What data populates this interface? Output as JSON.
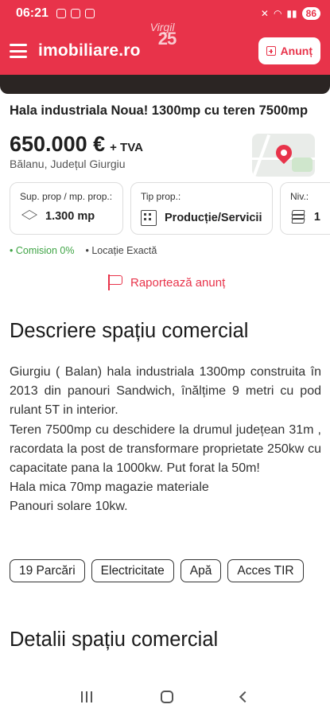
{
  "status_bar": {
    "time": "06:21",
    "battery": "86"
  },
  "header": {
    "logo": "imobiliare.ro",
    "badge_top": "Virgil",
    "badge_number": "25",
    "announce_label": "Anunț"
  },
  "listing": {
    "title": "Hala industriala Noua! 1300mp cu teren 7500mp",
    "price": "650.000 €",
    "vat": "+ TVA",
    "location": "Bălanu, Județul Giurgiu"
  },
  "specs": [
    {
      "label": "Sup. prop / mp. prop.:",
      "value": "1.300 mp",
      "icon": "area-icon"
    },
    {
      "label": "Tip prop.:",
      "value": "Producție/Servicii",
      "icon": "building-icon"
    },
    {
      "label": "Niv.:",
      "value": "1",
      "icon": "layers-icon"
    }
  ],
  "flags": {
    "commission": "Comision 0%",
    "exact_location": "Locație Exactă"
  },
  "report_label": "Raportează anunț",
  "description": {
    "heading": "Descriere spațiu comercial",
    "lines": [
      "Giurgiu ( Balan) hala industriala 1300mp construita în 2013 din panouri Sandwich, înălțime 9 metri cu pod rulant 5T in interior.",
      "Teren 7500mp cu deschidere la drumul județean 31m , racordata la post de transformare proprietate 250kw cu capacitate pana la 1000kw. Put forat la 50m!",
      "Hala mica 70mp magazie materiale",
      "Panouri solare 10kw."
    ]
  },
  "tags": [
    "19 Parcări",
    "Electricitate",
    "Apă",
    "Acces TIR"
  ],
  "details": {
    "heading": "Detalii spațiu comercial"
  },
  "colors": {
    "brand": "#e8334a",
    "commission": "#3fa445"
  }
}
